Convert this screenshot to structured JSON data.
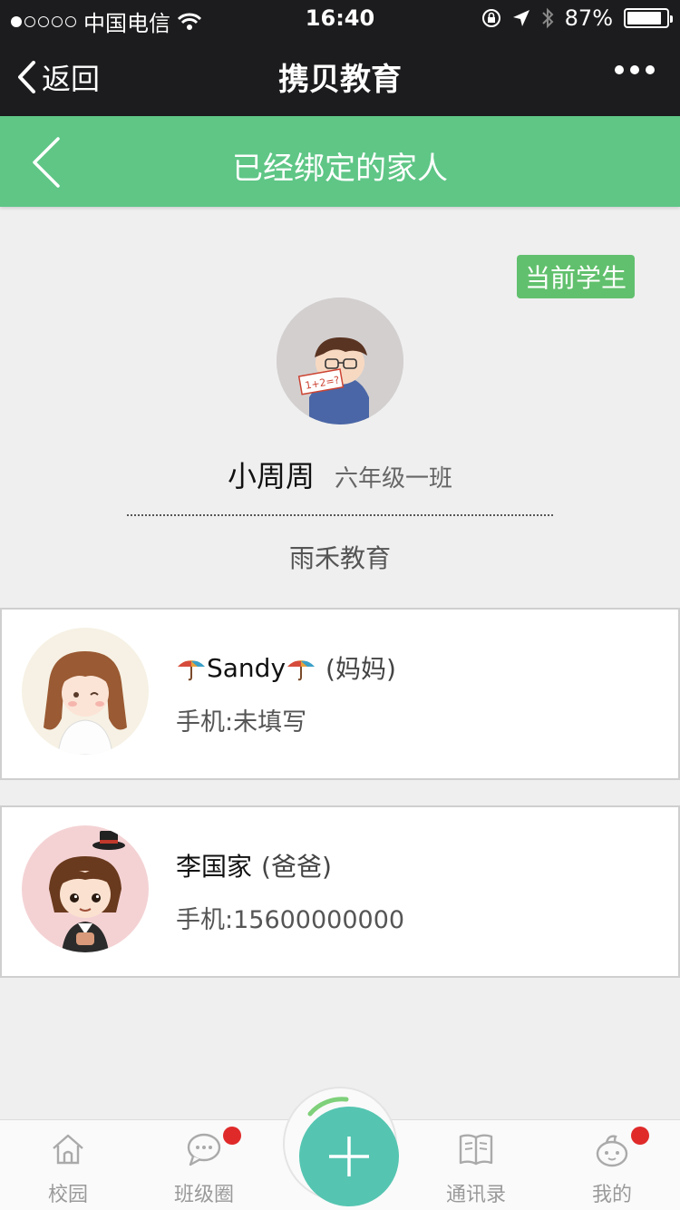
{
  "status_bar": {
    "carrier": "中国电信",
    "time": "16:40",
    "battery": "87%",
    "battery_level": 0.87
  },
  "nav": {
    "back_label": "返回",
    "title": "携贝教育"
  },
  "header": {
    "title": "已经绑定的家人"
  },
  "student": {
    "badge": "当前学生",
    "name": "小周周",
    "class": "六年级一班",
    "school": "雨禾教育"
  },
  "family": [
    {
      "name": "Sandy",
      "relation": "(妈妈)",
      "phone": "手机:未填写"
    },
    {
      "name": "李国家",
      "relation": "(爸爸)",
      "phone": "手机:15600000000"
    }
  ],
  "tabbar": {
    "tabs": [
      {
        "label": "校园",
        "icon": "house-icon"
      },
      {
        "label": "班级圈",
        "icon": "chat-bubble-icon"
      },
      {
        "label": "通讯录",
        "icon": "book-icon"
      },
      {
        "label": "我的",
        "icon": "profile-icon"
      }
    ],
    "accent": "#55c5b1"
  },
  "colors": {
    "header_green": "#5fc686",
    "badge_green": "#61c06d",
    "notification_red": "#e02a2a"
  }
}
